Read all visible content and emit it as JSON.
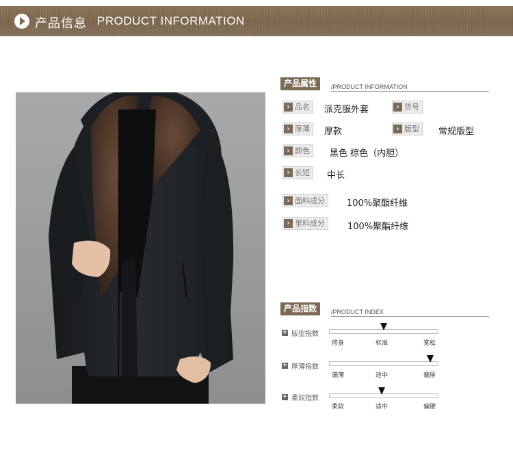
{
  "header": {
    "title_cn": "产品信息",
    "title_en": "PRODUCT INFORMATION"
  },
  "attributes_section": {
    "tag": "产品属性",
    "subtitle": "/PRODUCT INFORMATION",
    "rows": [
      {
        "label": "品名",
        "value": "派克服外套"
      },
      {
        "label": "货号",
        "value": ""
      },
      {
        "label": "厚薄",
        "value": "厚款"
      },
      {
        "label": "版型",
        "value": "常规版型"
      },
      {
        "label": "颜色",
        "value": "黑色 棕色（内胆）"
      },
      {
        "label": "长短",
        "value": "中长"
      },
      {
        "label": "面料成分",
        "value": "100%聚酯纤维"
      },
      {
        "label": "里料成分",
        "value": "100%聚酯纤维"
      }
    ]
  },
  "index_section": {
    "tag": "产品指数",
    "subtitle": "/PRODUCT INDEX",
    "rows": [
      {
        "label": "版型指数",
        "ticks": [
          "修身",
          "标准",
          "宽松"
        ],
        "level": 0.5
      },
      {
        "label": "厚薄指数",
        "ticks": [
          "偏薄",
          "适中",
          "偏厚"
        ],
        "level": 0.93
      },
      {
        "label": "柔软指数",
        "ticks": [
          "柔软",
          "适中",
          "偏硬"
        ],
        "level": 0.48
      }
    ]
  },
  "colors": {
    "banner": "#7d684e",
    "tag_bg": "#7d6a56",
    "coat": "#1f2226",
    "fur": "#4a3326",
    "photo_bg": "#9c9c9e"
  }
}
